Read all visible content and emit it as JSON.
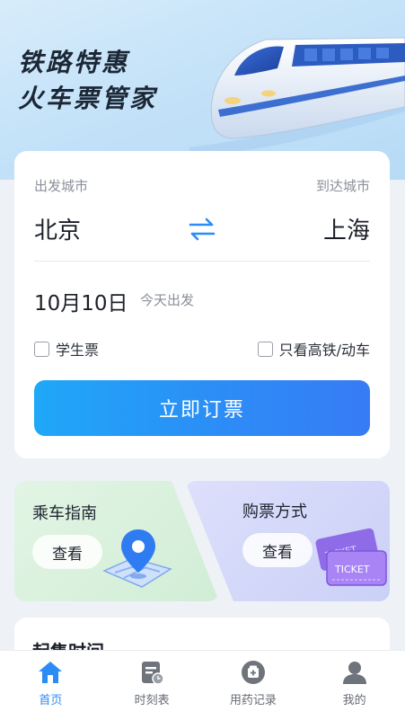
{
  "hero": {
    "title_line1": "铁路特惠",
    "title_line2": "火车票管家"
  },
  "booking": {
    "from_label": "出发城市",
    "to_label": "到达城市",
    "from_city": "北京",
    "to_city": "上海",
    "swap_icon": "swap-arrows-icon",
    "date": "10月10日",
    "date_note": "今天出发",
    "student_ticket": "学生票",
    "high_speed_only": "只看高铁/动车",
    "book_button": "立即订票"
  },
  "tiles": {
    "guide_title": "乘车指南",
    "guide_button": "查看",
    "purchase_title": "购票方式",
    "purchase_button": "查看",
    "ticket_text_front": "TICKET",
    "ticket_text_back": "TICKET"
  },
  "section": {
    "title": "起售时间"
  },
  "tabbar": {
    "items": [
      {
        "label": "首页",
        "icon": "home-icon",
        "active": true
      },
      {
        "label": "时刻表",
        "icon": "timetable-icon",
        "active": false
      },
      {
        "label": "用药记录",
        "icon": "medicine-record-icon",
        "active": false
      },
      {
        "label": "我的",
        "icon": "profile-icon",
        "active": false
      }
    ]
  },
  "colors": {
    "accent": "#2b8cf6",
    "button_gradient_start": "#1fa8f8",
    "button_gradient_end": "#377bf5"
  }
}
